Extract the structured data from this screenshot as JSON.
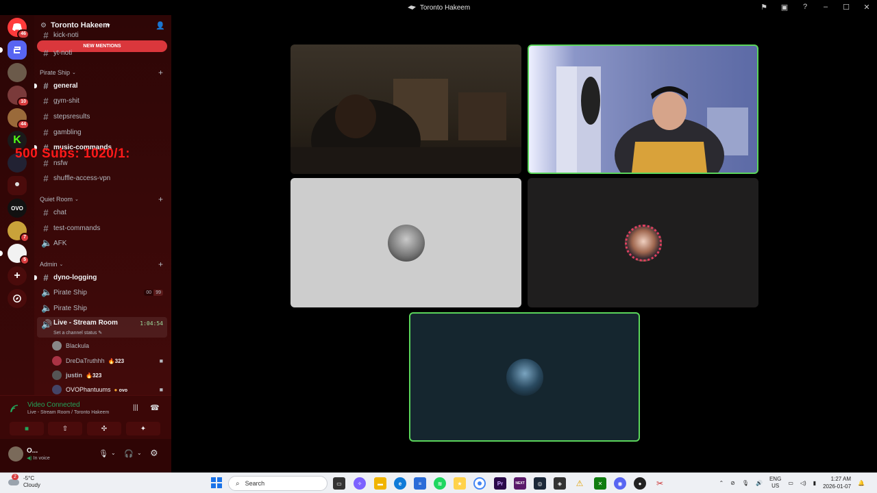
{
  "window": {
    "title": "Toronto Hakeem"
  },
  "rail": {
    "badges": [
      "46",
      "10",
      "44",
      "7",
      "5"
    ],
    "colors": {
      "dm": "#ff3b3b",
      "home": "#5865f2"
    }
  },
  "server": {
    "name": "Toronto Hakeem",
    "new_mentions": "NEW MENTIONS",
    "partial_channels": [
      "kick-noti",
      "yt-noti"
    ]
  },
  "categories": {
    "pirate": "Pirate Ship",
    "quiet": "Quiet Room",
    "admin": "Admin"
  },
  "channels": {
    "general": "general",
    "gym": "gym-shit",
    "steps": "stepsresults",
    "gambling": "gambling",
    "music": "music-commands",
    "nsfw": "nsfw",
    "shuffle": "shuffle-access-vpn",
    "chat": "chat",
    "test": "test-commands",
    "afk": "AFK",
    "dyno": "dyno-logging",
    "voice1": "Pirate Ship",
    "voice1_counts": [
      "00",
      "99"
    ],
    "voice2": "Pirate Ship",
    "live": "Live - Stream Room",
    "live_timer": "1:04:54",
    "live_status": "Set a channel status"
  },
  "voice_users": [
    {
      "name": "Blackula",
      "tag": "",
      "cam": false
    },
    {
      "name": "DreDaTruthhh",
      "tag": "323",
      "cam": true
    },
    {
      "name": "justin",
      "tag": "323",
      "cam": false
    },
    {
      "name": "OVOPhantuums",
      "tag": "ovo",
      "cam": true
    }
  ],
  "overlay": "500 Subs: 1020/1:",
  "voice": {
    "status": "Video Connected",
    "location": "Live - Stream Room / Toronto Hakeem"
  },
  "user": {
    "name": "O...",
    "status": "In voice"
  },
  "taskbar": {
    "weather_temp": "-5°C",
    "weather_desc": "Cloudy",
    "weather_badge": "2",
    "search_placeholder": "Search",
    "lang": "ENG",
    "region": "US",
    "time": "1:27 AM",
    "date": "2026-01-07",
    "premiere": "Pr",
    "next": "NEXT"
  },
  "colors": {
    "speaking": "#5bd65b",
    "accent_red": "#da373c",
    "voice_green": "#23a55a"
  }
}
